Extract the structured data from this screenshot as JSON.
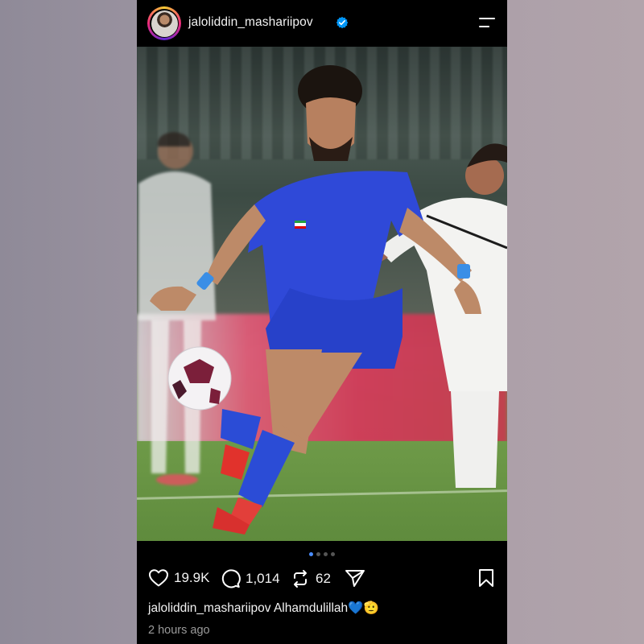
{
  "header": {
    "username": "jaloliddin_mashariipov",
    "verified": true
  },
  "post": {
    "carousel": {
      "count": 4,
      "active_index": 0
    },
    "photo_description_icon": "football-photo"
  },
  "actions": {
    "likes": "19.9K",
    "comments": "1,014",
    "reposts": "62"
  },
  "caption": {
    "username": "jaloliddin_mashariipov",
    "text": "Alhamdulillah💙🫡"
  },
  "timestamp": "2 hours ago",
  "colors": {
    "background": "#000000",
    "verified_blue": "#0095f6",
    "active_dot": "#4a8dff",
    "jersey_blue": "#2f49d8"
  }
}
